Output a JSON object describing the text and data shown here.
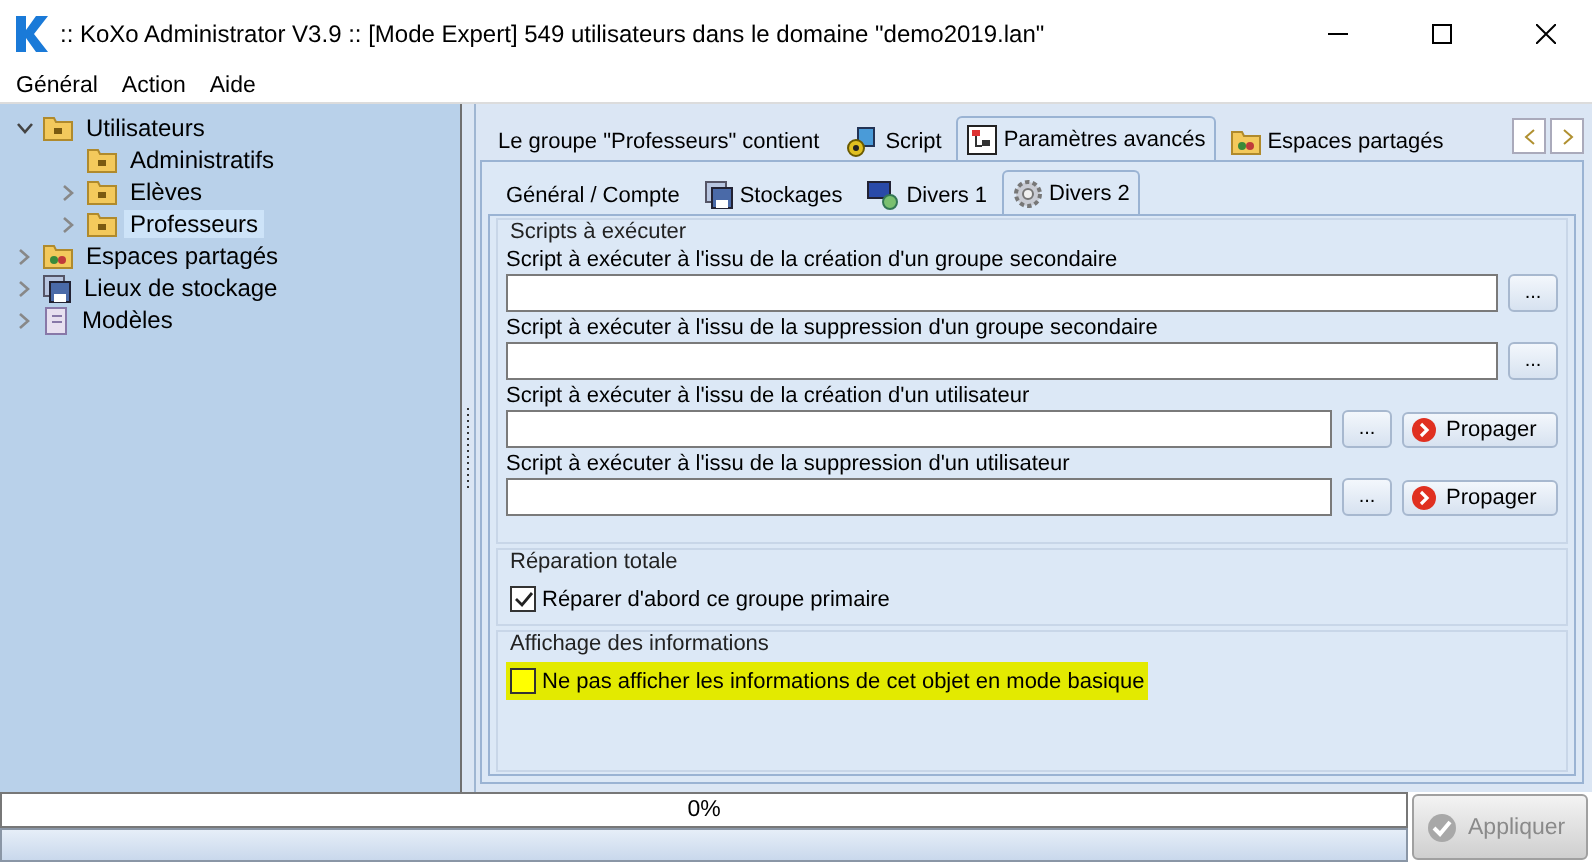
{
  "window": {
    "title": ":: KoXo Administrator V3.9 :: [Mode Expert] 549 utilisateurs dans le domaine \"demo2019.lan\""
  },
  "menu": [
    "Général",
    "Action",
    "Aide"
  ],
  "tree": [
    {
      "label": "Utilisateurs",
      "expanded": true,
      "selected": false,
      "children": [
        {
          "label": "Administratifs",
          "selected": false
        },
        {
          "label": "Elèves",
          "expanded": false,
          "selected": false
        },
        {
          "label": "Professeurs",
          "expanded": false,
          "selected": true
        }
      ]
    },
    {
      "label": "Espaces partagés",
      "expanded": false,
      "selected": false
    },
    {
      "label": "Lieux de stockage",
      "expanded": false,
      "selected": false
    },
    {
      "label": "Modèles",
      "expanded": false,
      "selected": false
    }
  ],
  "tabs": [
    {
      "label": "Le groupe \"Professeurs\" contient",
      "selected": false
    },
    {
      "label": "Script",
      "selected": false
    },
    {
      "label": "Paramètres avancés",
      "selected": true
    },
    {
      "label": "Espaces partagés",
      "selected": false
    }
  ],
  "subtabs": [
    {
      "label": "Général / Compte",
      "selected": false
    },
    {
      "label": "Stockages",
      "selected": false
    },
    {
      "label": "Divers 1",
      "selected": false
    },
    {
      "label": "Divers 2",
      "selected": true
    }
  ],
  "scripts": {
    "title": "Scripts à exécuter",
    "rows": [
      {
        "label": "Script à exécuter à l'issu de la création d'un groupe secondaire",
        "browse": "...",
        "kind": "plain"
      },
      {
        "label": "Script à exécuter  à l'issu de la suppression d'un groupe secondaire",
        "browse": "...",
        "kind": "plain"
      },
      {
        "label": "Script à exécuter à l'issu de la création d'un utilisateur",
        "browse": "...",
        "kind": "propagate",
        "propagate": "Propager"
      },
      {
        "label": "Script à exécuter  à l'issu de la suppression d'un utilisateur",
        "browse": "...",
        "kind": "propagate",
        "propagate": "Propager"
      }
    ]
  },
  "options": [
    {
      "title": "Réparation totale",
      "label": "Réparer d'abord ce groupe primaire",
      "checked": true,
      "highlighted": false
    },
    {
      "title": "Affichage des informations",
      "label": "Ne pas afficher les informations de cet objet en mode basique",
      "checked": false,
      "highlighted": true
    }
  ],
  "progress": {
    "text": "0%",
    "level": 0
  },
  "apply": {
    "label": "Appliquer",
    "disabled": true
  }
}
